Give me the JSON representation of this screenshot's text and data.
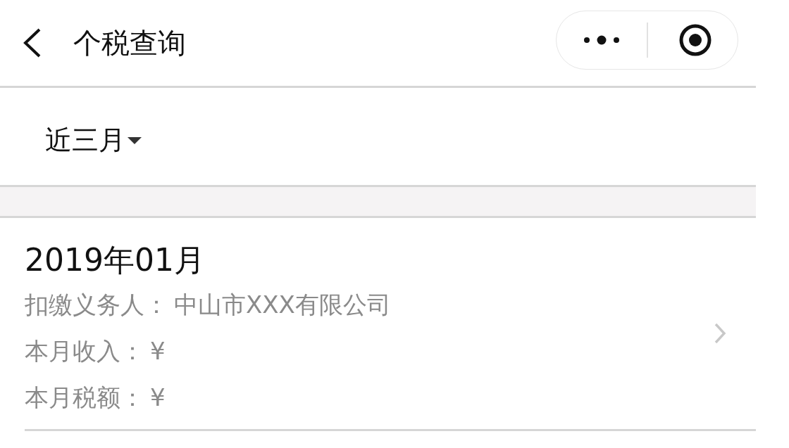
{
  "nav": {
    "title": "个税查询"
  },
  "filter": {
    "label": "近三月"
  },
  "records": [
    {
      "month": "2019年01月",
      "fields": [
        {
          "label": "扣缴义务人：",
          "value": "中山市XXX有限公司"
        },
        {
          "label": "本月收入：",
          "value": "¥"
        },
        {
          "label": "本月税额：",
          "value": "¥"
        }
      ]
    }
  ]
}
